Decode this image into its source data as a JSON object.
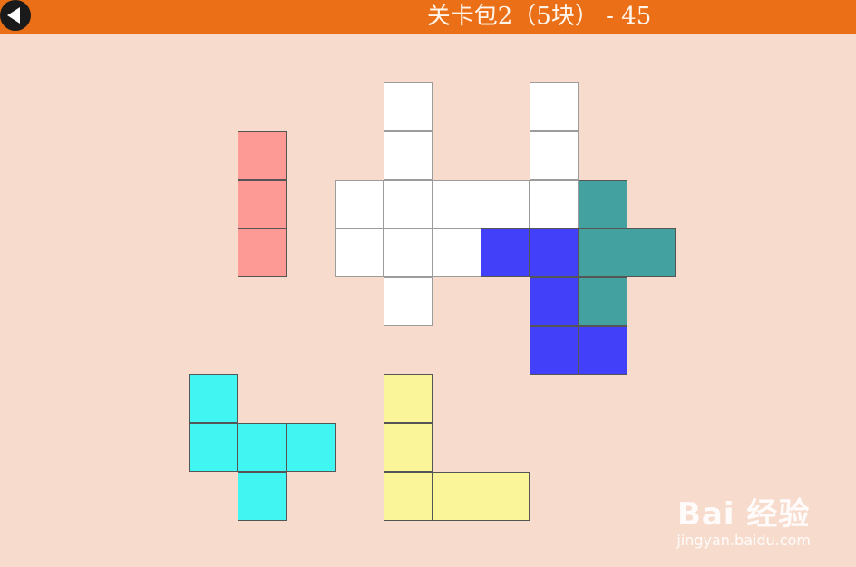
{
  "header": {
    "title": "关卡包2（5块） - 45",
    "back_icon": "back-arrow-icon"
  },
  "colors": {
    "header_bg": "#ea6f17",
    "page_bg": "#f7dccd",
    "salmon": "#fe9a96",
    "white": "#ffffff",
    "teal": "#43a2a0",
    "blue": "#4240f9",
    "cyan": "#41f6f2",
    "yellow": "#fbf599"
  },
  "pieces": [
    {
      "name": "salmon-piece",
      "color": "salmon",
      "cells": [
        [
          4,
          2
        ],
        [
          4,
          3
        ],
        [
          4,
          4
        ]
      ]
    },
    {
      "name": "white-target-area",
      "color": "white",
      "cells": [
        [
          7,
          1
        ],
        [
          10,
          1
        ],
        [
          7,
          2
        ],
        [
          10,
          2
        ],
        [
          6,
          3
        ],
        [
          7,
          3
        ],
        [
          8,
          3
        ],
        [
          9,
          3
        ],
        [
          10,
          3
        ],
        [
          6,
          4
        ],
        [
          7,
          4
        ],
        [
          8,
          4
        ],
        [
          7,
          5
        ]
      ]
    },
    {
      "name": "teal-piece",
      "color": "teal",
      "cells": [
        [
          11,
          3
        ],
        [
          11,
          4
        ],
        [
          12,
          4
        ],
        [
          11,
          5
        ]
      ]
    },
    {
      "name": "blue-piece",
      "color": "blue",
      "cells": [
        [
          9,
          4
        ],
        [
          10,
          4
        ],
        [
          10,
          5
        ],
        [
          10,
          6
        ],
        [
          11,
          6
        ]
      ]
    },
    {
      "name": "cyan-piece",
      "color": "cyan",
      "cells": [
        [
          3,
          7
        ],
        [
          3,
          8
        ],
        [
          4,
          8
        ],
        [
          5,
          8
        ],
        [
          4,
          9
        ]
      ]
    },
    {
      "name": "yellow-piece",
      "color": "yellow",
      "cells": [
        [
          7,
          7
        ],
        [
          7,
          8
        ],
        [
          7,
          9
        ],
        [
          8,
          9
        ],
        [
          9,
          9
        ]
      ]
    }
  ],
  "watermark": {
    "main": "Bai 经验",
    "sub": "jingyan.baidu.com"
  }
}
